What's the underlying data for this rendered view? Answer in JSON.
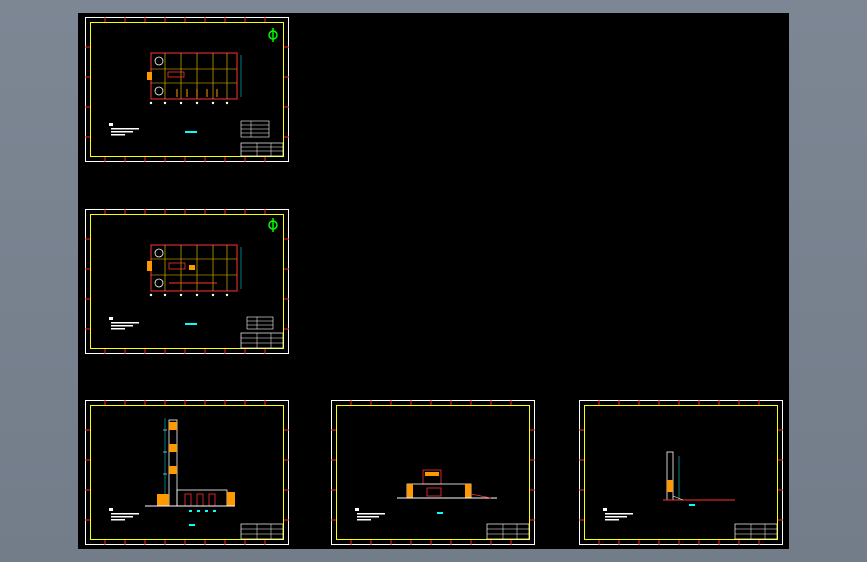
{
  "colors": {
    "workspace": "#737d8a",
    "canvas": "#000000",
    "sheet_border_outer": "#ffffff",
    "sheet_border_inner": "#ffff00",
    "tick": "#ff2020",
    "wall": "#ff3030",
    "axis": "#ffcc00",
    "orange": "#ff9900",
    "cyan": "#00ffff",
    "green": "#00ff00"
  },
  "sheets": [
    {
      "id": "sheet-1",
      "kind": "plan"
    },
    {
      "id": "sheet-2",
      "kind": "plan"
    },
    {
      "id": "sheet-3",
      "kind": "elevation-tower"
    },
    {
      "id": "sheet-4",
      "kind": "elevation-low"
    },
    {
      "id": "sheet-5",
      "kind": "elevation-pole"
    }
  ]
}
